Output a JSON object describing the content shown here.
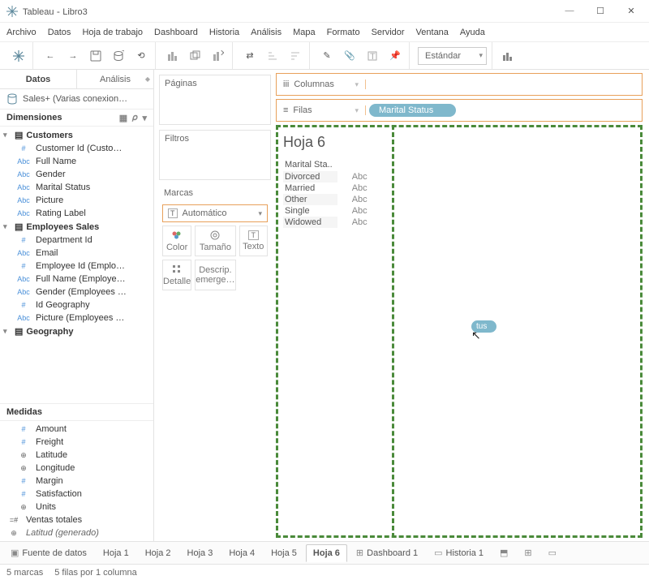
{
  "titlebar": {
    "app": "Tableau",
    "doc": "Libro3"
  },
  "menubar": [
    "Archivo",
    "Datos",
    "Hoja de trabajo",
    "Dashboard",
    "Historia",
    "Análisis",
    "Mapa",
    "Formato",
    "Servidor",
    "Ventana",
    "Ayuda"
  ],
  "toolbar": {
    "fit_select": "Estándar"
  },
  "left": {
    "tab_data": "Datos",
    "tab_analysis": "Análisis",
    "datasource": "Sales+ (Varias conexion…",
    "dimensions_label": "Dimensiones",
    "measures_label": "Medidas",
    "groups": [
      {
        "name": "Customers",
        "items": [
          {
            "type": "#",
            "label": "Customer Id (Custo…"
          },
          {
            "type": "Abc",
            "label": "Full Name"
          },
          {
            "type": "Abc",
            "label": "Gender"
          },
          {
            "type": "Abc",
            "label": "Marital Status"
          },
          {
            "type": "Abc",
            "label": "Picture"
          },
          {
            "type": "Abc",
            "label": "Rating Label"
          }
        ]
      },
      {
        "name": "Employees Sales",
        "items": [
          {
            "type": "#",
            "label": "Department Id"
          },
          {
            "type": "Abc",
            "label": "Email"
          },
          {
            "type": "#",
            "label": "Employee Id (Emplo…"
          },
          {
            "type": "Abc",
            "label": "Full Name (Employe…"
          },
          {
            "type": "Abc",
            "label": "Gender (Employees …"
          },
          {
            "type": "#",
            "label": "Id Geography"
          },
          {
            "type": "Abc",
            "label": "Picture (Employees …"
          }
        ]
      },
      {
        "name": "Geography",
        "items": []
      }
    ],
    "measures": [
      {
        "type": "#",
        "label": "Amount"
      },
      {
        "type": "#",
        "label": "Freight"
      },
      {
        "type": "⊕",
        "label": "Latitude"
      },
      {
        "type": "⊕",
        "label": "Longitude"
      },
      {
        "type": "#",
        "label": "Margin"
      },
      {
        "type": "#",
        "label": "Satisfaction"
      },
      {
        "type": "⊕",
        "label": "Units"
      },
      {
        "type": "=#",
        "label": "Ventas totales",
        "calc": true
      },
      {
        "type": "⊕",
        "label": "Latitud (generado)",
        "italic": true
      }
    ]
  },
  "cards": {
    "pages": "Páginas",
    "filters": "Filtros",
    "marks": "Marcas",
    "marks_type": "Automático",
    "mark_cells": [
      "Color",
      "Tamaño",
      "Texto",
      "Detalle",
      "Descrip. emerge…"
    ]
  },
  "shelves": {
    "columns": "Columnas",
    "rows": "Filas",
    "row_pill": "Marital Status"
  },
  "worksheet": {
    "title": "Hoja 6",
    "header": "Marital Sta..",
    "rows": [
      {
        "k": "Divorced",
        "v": "Abc"
      },
      {
        "k": "Married",
        "v": "Abc"
      },
      {
        "k": "Other",
        "v": "Abc"
      },
      {
        "k": "Single",
        "v": "Abc"
      },
      {
        "k": "Widowed",
        "v": "Abc"
      }
    ],
    "drag_pill": "tus"
  },
  "bottom_tabs": {
    "datasource": "Fuente de datos",
    "sheets": [
      "Hoja 1",
      "Hoja 2",
      "Hoja 3",
      "Hoja 4",
      "Hoja 5",
      "Hoja 6"
    ],
    "active": "Hoja 6",
    "dashboard": "Dashboard 1",
    "story": "Historia 1"
  },
  "status": {
    "marks": "5 marcas",
    "rows": "5 filas por 1 columna"
  }
}
